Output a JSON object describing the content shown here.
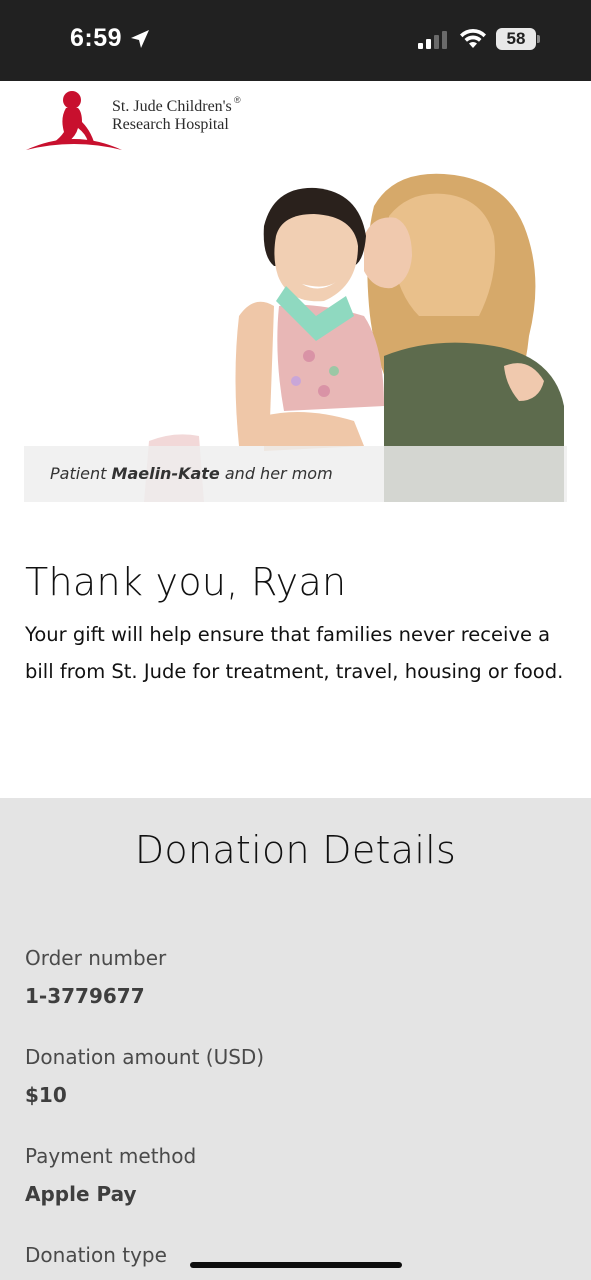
{
  "status_bar": {
    "time": "6:59",
    "battery_level": "58",
    "icons": [
      "location-arrow-icon",
      "cellular-signal-icon",
      "wifi-icon",
      "battery-icon"
    ]
  },
  "logo": {
    "line1": "St. Jude Children's",
    "line2": "Research Hospital",
    "registered": "®",
    "brand_color": "#c8102e"
  },
  "hero": {
    "caption_prefix": "Patient ",
    "caption_name": "Maelin-Kate",
    "caption_suffix": " and her mom"
  },
  "thank_you": {
    "title": "Thank you, Ryan",
    "body": "Your gift will help ensure that families never receive a bill from St. Jude for treatment, travel, housing or food."
  },
  "donation_details": {
    "title": "Donation Details",
    "fields": [
      {
        "label": "Order number",
        "value": "1-3779677"
      },
      {
        "label": "Donation amount (USD)",
        "value": "$10"
      },
      {
        "label": "Payment method",
        "value": "Apple Pay"
      },
      {
        "label": "Donation type",
        "value": ""
      }
    ]
  }
}
